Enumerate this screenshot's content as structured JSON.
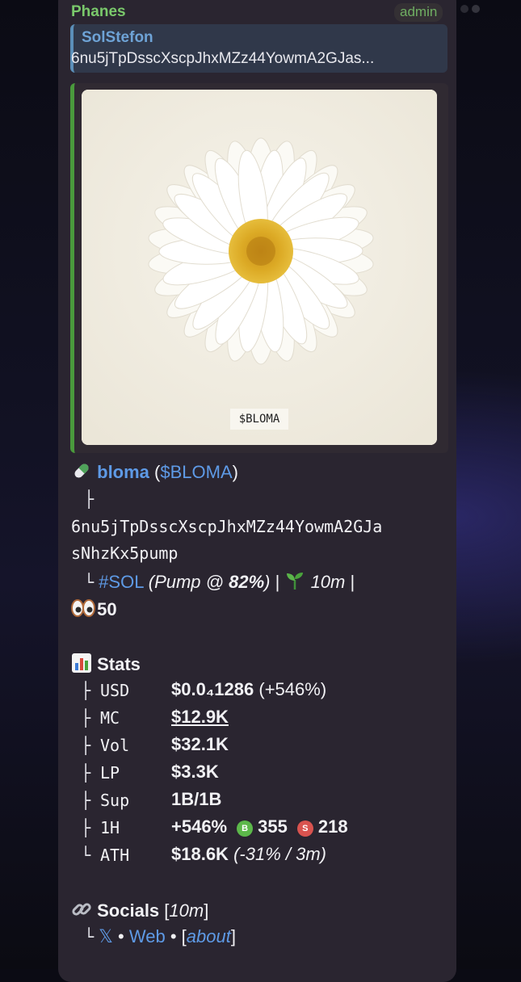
{
  "message": {
    "sender": "Phanes",
    "role_badge": "admin",
    "reply": {
      "name": "SolStefon",
      "text": "6nu5jTpDsscXscpJhxMZz44YowmA2GJas..."
    },
    "media": {
      "caption_label": "$BLOMA"
    },
    "token": {
      "name": "bloma",
      "symbol": "$BLOMA",
      "address_line1": "6nu5jTpDsscXscpJhxMZz44YowmA2GJa",
      "address_line2": "sNhzKx5pump",
      "chain": "#SOL",
      "pump_text": "(Pump @ ",
      "pump_pct": "82%",
      "pump_close": ")",
      "age": "10m",
      "watchers": "50"
    },
    "stats": {
      "title": "Stats",
      "rows": [
        {
          "label": "USD",
          "value": "$0.0₄1286",
          "extra": "(+546%)"
        },
        {
          "label": "MC",
          "value": "$12.9K",
          "extra": ""
        },
        {
          "label": "Vol",
          "value": "$32.1K",
          "extra": ""
        },
        {
          "label": "LP",
          "value": "$3.3K",
          "extra": ""
        },
        {
          "label": "Sup",
          "value": "1B/1B",
          "extra": ""
        },
        {
          "label": "1H",
          "value": "+546%",
          "extra": ""
        },
        {
          "label": "ATH",
          "value": "$18.6K",
          "extra": "(-31% / 3m)"
        }
      ],
      "buys_badge": "B",
      "buys": "355",
      "sells_badge": "S",
      "sells": "218"
    },
    "socials": {
      "title": "Socials",
      "age": "10m",
      "x": "𝕏",
      "web": "Web",
      "about": "about"
    }
  },
  "colors": {
    "bubble_bg": "#2a2530",
    "link": "#5e9ae6",
    "sender": "#7ac96b",
    "buy": "#5cb84a",
    "sell": "#d9534f"
  }
}
